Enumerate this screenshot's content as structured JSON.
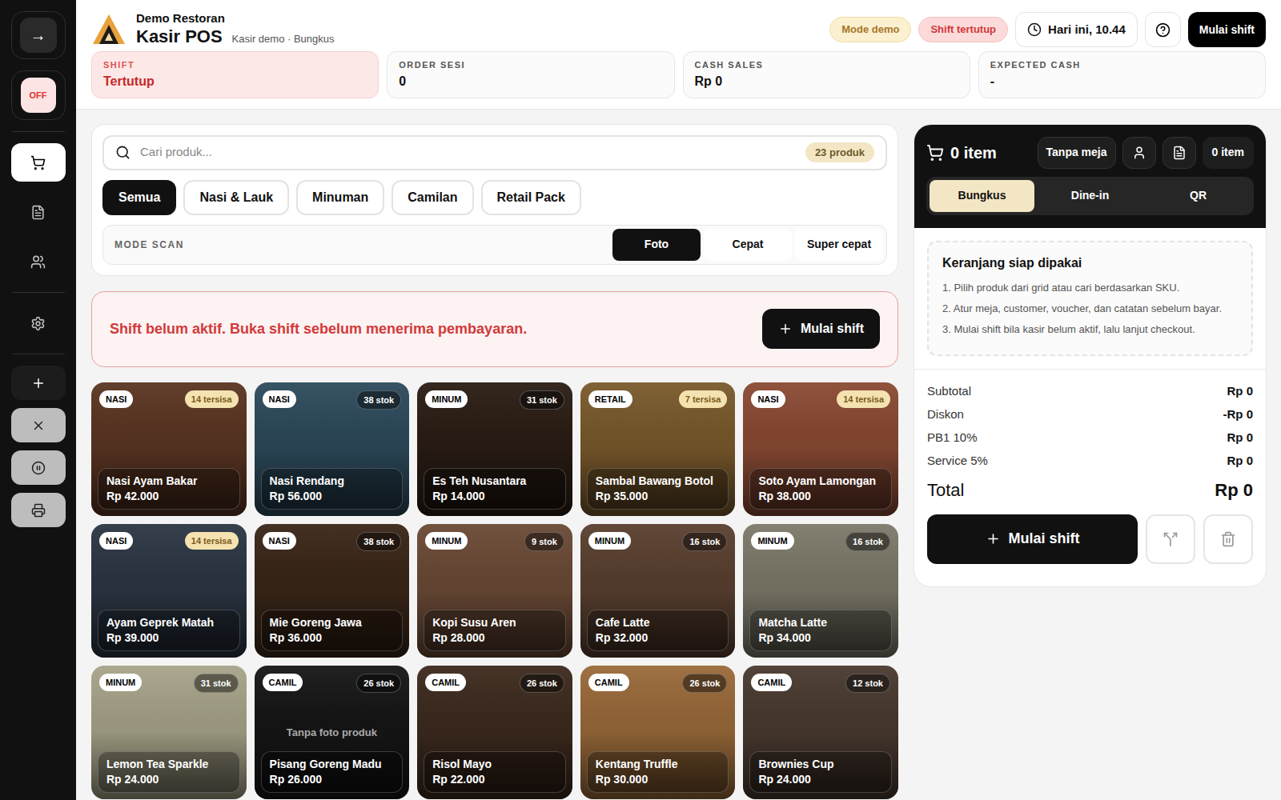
{
  "sidebar": {
    "toggle": "→",
    "status_badge": "OFF",
    "nav": [
      {
        "selected": true
      },
      {
        "selected": false
      },
      {
        "selected": false
      },
      {
        "selected": false
      }
    ],
    "actions": [
      {
        "disabled": false
      },
      {
        "disabled": true
      },
      {
        "disabled": true
      },
      {
        "disabled": true
      }
    ]
  },
  "header": {
    "restaurant": "Demo Restoran",
    "title": "Kasir POS",
    "subtitle": "Kasir demo · Bungkus",
    "badges": [
      {
        "label": "Mode demo",
        "color": "#a5782a"
      },
      {
        "label": "Shift tertutup",
        "color": "#d03838"
      }
    ],
    "clock": "Hari ini, 10.44",
    "primary_button": "Mulai shift"
  },
  "stats": [
    {
      "label": "SHIFT",
      "value": "Tertutup",
      "alert": true
    },
    {
      "label": "ORDER SESI",
      "value": "0",
      "alert": false
    },
    {
      "label": "CASH SALES",
      "value": "Rp 0",
      "alert": false
    },
    {
      "label": "EXPECTED CASH",
      "value": "-",
      "alert": false
    }
  ],
  "search": {
    "placeholder": "Cari produk...",
    "count": "23 produk"
  },
  "categories": [
    {
      "label": "Semua",
      "selected": true
    },
    {
      "label": "Nasi & Lauk",
      "selected": false
    },
    {
      "label": "Minuman",
      "selected": false
    },
    {
      "label": "Camilan",
      "selected": false
    },
    {
      "label": "Retail Pack",
      "selected": false
    }
  ],
  "scan_mode": {
    "label": "MODE SCAN",
    "options": [
      {
        "label": "Foto",
        "selected": true
      },
      {
        "label": "Cepat",
        "selected": false
      },
      {
        "label": "Super cepat",
        "selected": false
      }
    ]
  },
  "alert": {
    "message": "Shift belum aktif. Buka shift sebelum menerima pembayaran.",
    "button": "Mulai shift"
  },
  "products": [
    {
      "category": "NASI",
      "stock": "14 tersisa",
      "low_stock": true,
      "name": "Nasi Ayam Bakar",
      "price": "Rp 42.000",
      "has_photo": true
    },
    {
      "category": "NASI",
      "stock": "38 stok",
      "low_stock": false,
      "name": "Nasi Rendang",
      "price": "Rp 56.000",
      "has_photo": true
    },
    {
      "category": "MINUM",
      "stock": "31 stok",
      "low_stock": false,
      "name": "Es Teh Nusantara",
      "price": "Rp 14.000",
      "has_photo": true
    },
    {
      "category": "RETAIL",
      "stock": "7 tersisa",
      "low_stock": true,
      "name": "Sambal Bawang Botol",
      "price": "Rp 35.000",
      "has_photo": true
    },
    {
      "category": "NASI",
      "stock": "14 tersisa",
      "low_stock": true,
      "name": "Soto Ayam Lamongan",
      "price": "Rp 38.000",
      "has_photo": true
    },
    {
      "category": "NASI",
      "stock": "14 tersisa",
      "low_stock": true,
      "name": "Ayam Geprek Matah",
      "price": "Rp 39.000",
      "has_photo": true
    },
    {
      "category": "NASI",
      "stock": "38 stok",
      "low_stock": false,
      "name": "Mie Goreng Jawa",
      "price": "Rp 36.000",
      "has_photo": true
    },
    {
      "category": "MINUM",
      "stock": "9 stok",
      "low_stock": false,
      "name": "Kopi Susu Aren",
      "price": "Rp 28.000",
      "has_photo": true
    },
    {
      "category": "MINUM",
      "stock": "16 stok",
      "low_stock": false,
      "name": "Cafe Latte",
      "price": "Rp 32.000",
      "has_photo": true
    },
    {
      "category": "MINUM",
      "stock": "16 stok",
      "low_stock": false,
      "name": "Matcha Latte",
      "price": "Rp 34.000",
      "has_photo": true
    },
    {
      "category": "MINUM",
      "stock": "31 stok",
      "low_stock": false,
      "name": "Lemon Tea Sparkle",
      "price": "Rp 24.000",
      "has_photo": true
    },
    {
      "category": "CAMIL",
      "stock": "26 stok",
      "low_stock": false,
      "name": "Pisang Goreng Madu",
      "price": "Rp 26.000",
      "has_photo": false,
      "photo_placeholder": "Tanpa foto produk"
    },
    {
      "category": "CAMIL",
      "stock": "26 stok",
      "low_stock": false,
      "name": "Risol Mayo",
      "price": "Rp 22.000",
      "has_photo": true
    },
    {
      "category": "CAMIL",
      "stock": "26 stok",
      "low_stock": false,
      "name": "Kentang Truffle",
      "price": "Rp 30.000",
      "has_photo": true
    },
    {
      "category": "CAMIL",
      "stock": "12 stok",
      "low_stock": false,
      "name": "Brownies Cup",
      "price": "Rp 24.000",
      "has_photo": true
    }
  ],
  "cart": {
    "title": "0 item",
    "table": "Tanpa meja",
    "count_badge": "0 item",
    "order_types": [
      {
        "label": "Bungkus",
        "selected": true
      },
      {
        "label": "Dine-in",
        "selected": false
      },
      {
        "label": "QR",
        "selected": false
      }
    ],
    "empty": {
      "title": "Keranjang siap dipakai",
      "steps": [
        "1. Pilih produk dari grid atau cari berdasarkan SKU.",
        "2. Atur meja, customer, voucher, dan catatan sebelum bayar.",
        "3. Mulai shift bila kasir belum aktif, lalu lanjut checkout."
      ]
    },
    "summary": [
      {
        "label": "Subtotal",
        "value": "Rp 0"
      },
      {
        "label": "Diskon",
        "value": "-Rp 0"
      },
      {
        "label": "PB1 10%",
        "value": "Rp 0"
      },
      {
        "label": "Service 5%",
        "value": "Rp 0"
      }
    ],
    "total": {
      "label": "Total",
      "value": "Rp 0"
    },
    "checkout_button": "Mulai shift"
  }
}
